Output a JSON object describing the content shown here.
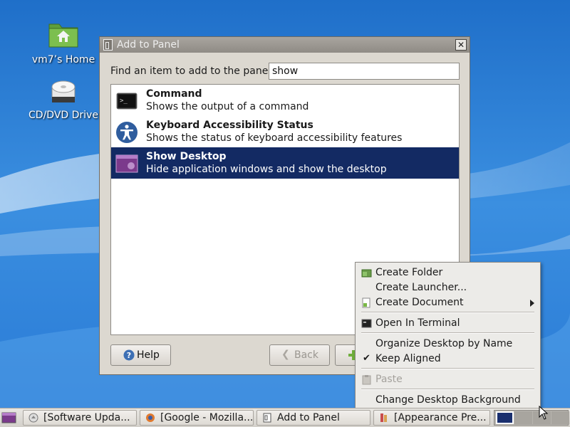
{
  "desktop": {
    "icons": [
      {
        "label": "vm7’s Home",
        "icon": "home-folder-icon"
      },
      {
        "label": "CD/DVD Drive",
        "icon": "optical-drive-icon"
      }
    ]
  },
  "dialog": {
    "title": "Add to Panel",
    "find_label": "Find an item to add to the panel:",
    "search_value": "show",
    "items": [
      {
        "name": "Command",
        "description": "Shows the output of a command",
        "icon": "terminal-icon"
      },
      {
        "name": "Keyboard Accessibility Status",
        "description": "Shows the status of keyboard accessibility features",
        "icon": "accessibility-icon"
      },
      {
        "name": "Show Desktop",
        "description": "Hide application windows and show the desktop",
        "icon": "show-desktop-icon",
        "selected": true
      }
    ],
    "buttons": {
      "help": "Help",
      "back": "Back"
    }
  },
  "context_menu": {
    "items": [
      {
        "label": "Create Folder",
        "icon": "folder-add-icon"
      },
      {
        "label": "Create Launcher..."
      },
      {
        "label": "Create Document",
        "icon": "document-add-icon",
        "submenu": true
      },
      {
        "label": "Open In Terminal",
        "icon": "terminal-icon"
      },
      {
        "label": "Organize Desktop by Name"
      },
      {
        "label": "Keep Aligned",
        "checked": true
      },
      {
        "label": "Paste",
        "icon": "paste-icon",
        "disabled": true
      },
      {
        "label": "Change Desktop Background"
      }
    ]
  },
  "taskbar": {
    "tasks": [
      {
        "label": "[Software Upda...",
        "icon": "software-update-icon"
      },
      {
        "label": "[Google - Mozilla...",
        "icon": "firefox-icon"
      },
      {
        "label": "Add to Panel",
        "icon": "window-icon"
      },
      {
        "label": "[Appearance Pre...",
        "icon": "appearance-icon"
      }
    ]
  },
  "colors": {
    "selection": "#132a63",
    "desktop_blue": "#2d7fd1",
    "titlebar": "#9a968f"
  }
}
